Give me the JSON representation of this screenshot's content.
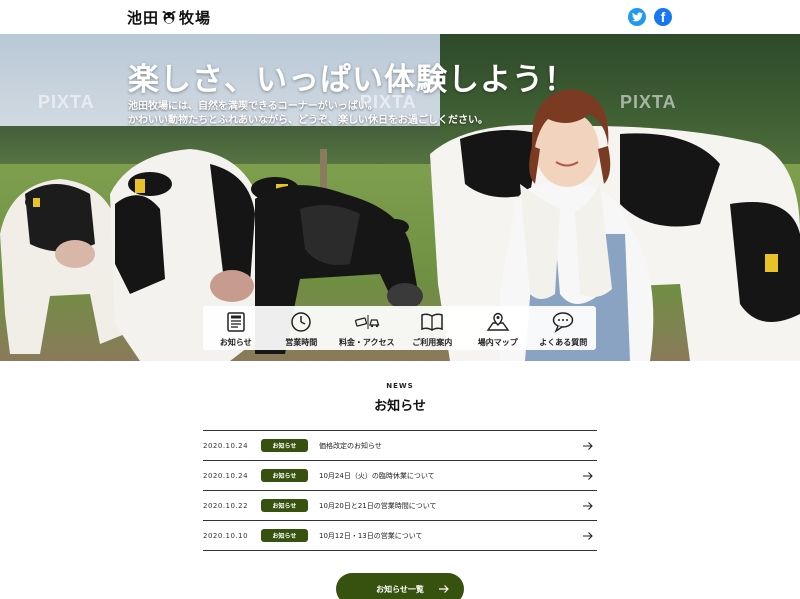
{
  "header": {
    "logo_left": "池田",
    "logo_right": "牧場",
    "social": [
      {
        "name": "twitter-icon",
        "color": "#1d9bf0"
      },
      {
        "name": "facebook-icon",
        "color": "#1877f2",
        "glyph": "f"
      }
    ]
  },
  "hero": {
    "title": "楽しさ、いっぱい体験しよう！",
    "subtitle_line1": "池田牧場には、自然を満喫できるコーナーがいっぱい。",
    "subtitle_line2": "かわいい動物たちとふれあいながら、どうぞ、楽しい休日をお過ごしください。",
    "watermark": "PIXTA"
  },
  "quicknav": [
    {
      "label": "お知らせ",
      "icon": "news-icon"
    },
    {
      "label": "営業時間",
      "icon": "clock-icon"
    },
    {
      "label": "料金・アクセス",
      "icon": "money-car-icon"
    },
    {
      "label": "ご利用案内",
      "icon": "book-icon"
    },
    {
      "label": "場内マップ",
      "icon": "map-icon"
    },
    {
      "label": "よくある質問",
      "icon": "chat-icon"
    }
  ],
  "news": {
    "heading_en": "NEWS",
    "heading_jp": "お知らせ",
    "items": [
      {
        "date": "2020.10.24",
        "badge": "お知らせ",
        "title": "価格改定のお知らせ"
      },
      {
        "date": "2020.10.24",
        "badge": "お知らせ",
        "title": "10月24日（火）の臨時休業について"
      },
      {
        "date": "2020.10.22",
        "badge": "お知らせ",
        "title": "10月20日と21日の営業時間について"
      },
      {
        "date": "2020.10.10",
        "badge": "お知らせ",
        "title": "10月12日・13日の営業について"
      }
    ],
    "more_label": "お知らせ一覧"
  },
  "colors": {
    "accent": "#37520f",
    "twitter": "#1d9bf0",
    "facebook": "#1877f2"
  }
}
